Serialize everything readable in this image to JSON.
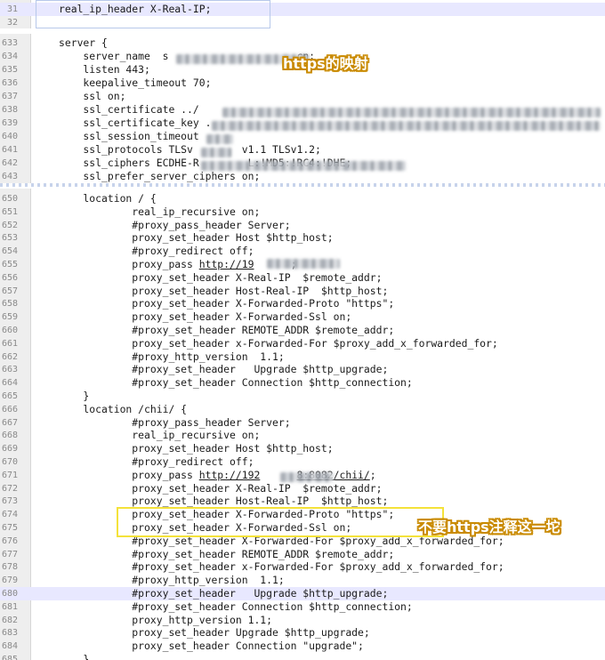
{
  "top_panel": {
    "lines": [
      {
        "num": "31",
        "text": "real_ip_header X-Real-IP;"
      },
      {
        "num": "32",
        "text": ""
      }
    ]
  },
  "main_panel": {
    "lines": [
      {
        "num": "633",
        "text": "server {"
      },
      {
        "num": "634",
        "text": "    server_name  s",
        "text_after": ".cn;"
      },
      {
        "num": "635",
        "text": "    listen 443;"
      },
      {
        "num": "636",
        "text": "    keepalive_timeout 70;"
      },
      {
        "num": "637",
        "text": "    ssl on;"
      },
      {
        "num": "638",
        "text": "    ssl_certificate ../"
      },
      {
        "num": "639",
        "text": "    ssl_certificate_key ."
      },
      {
        "num": "640",
        "text": "    ssl_session_timeout"
      },
      {
        "num": "641",
        "text": "    ssl_protocols TLSv",
        "text_after": "v1.1 TLSv1.2;"
      },
      {
        "num": "642",
        "text": "    ssl_ciphers ECDHE-R",
        "text_after": "L:!MD5:!RC4:!DHE;"
      },
      {
        "num": "643",
        "text": "    ssl_prefer_server_ciphers on;"
      }
    ]
  },
  "bottom_panel": {
    "lines": [
      {
        "num": "650",
        "text": "    location / {"
      },
      {
        "num": "651",
        "text": "            real_ip_recursive on;"
      },
      {
        "num": "652",
        "text": "            #proxy_pass_header Server;"
      },
      {
        "num": "653",
        "text": "            proxy_set_header Host $http_host;"
      },
      {
        "num": "654",
        "text": "            #proxy_redirect off;"
      },
      {
        "num": "655",
        "text": "            proxy_pass ",
        "link": "http://19",
        "text_after": ";"
      },
      {
        "num": "656",
        "text": "            proxy_set_header X-Real-IP  $remote_addr;"
      },
      {
        "num": "657",
        "text": "            proxy_set_header Host-Real-IP  $http_host;"
      },
      {
        "num": "658",
        "text": "            proxy_set_header X-Forwarded-Proto \"https\";"
      },
      {
        "num": "659",
        "text": "            proxy_set_header X-Forwarded-Ssl on;"
      },
      {
        "num": "660",
        "text": "            #proxy_set_header REMOTE_ADDR $remote_addr;"
      },
      {
        "num": "661",
        "text": "            proxy_set_header x-Forwarded-For $proxy_add_x_forwarded_for;"
      },
      {
        "num": "662",
        "text": "            #proxy_http_version  1.1;"
      },
      {
        "num": "663",
        "text": "            #proxy_set_header   Upgrade $http_upgrade;"
      },
      {
        "num": "664",
        "text": "            #proxy_set_header Connection $http_connection;"
      },
      {
        "num": "665",
        "text": "    }"
      },
      {
        "num": "666",
        "text": "    location /chii/ {"
      },
      {
        "num": "667",
        "text": "            #proxy_pass_header Server;"
      },
      {
        "num": "668",
        "text": "            real_ip_recursive on;"
      },
      {
        "num": "669",
        "text": "            proxy_set_header Host $http_host;"
      },
      {
        "num": "670",
        "text": "            #proxy_redirect off;"
      },
      {
        "num": "671",
        "text": "            proxy_pass ",
        "link": "http://192",
        "link_after": "8:8082/chii/",
        "text_after": ";"
      },
      {
        "num": "672",
        "text": "            proxy_set_header X-Real-IP  $remote_addr;"
      },
      {
        "num": "673",
        "text": "            proxy_set_header Host-Real-IP  $http_host;"
      },
      {
        "num": "674",
        "text": "            proxy_set_header X-Forwarded-Proto \"https\";"
      },
      {
        "num": "675",
        "text": "            proxy_set_header X-Forwarded-Ssl on;"
      },
      {
        "num": "676",
        "text": "            #proxy_set_header X-Forwarded-For $proxy_add_x_forwarded_for;"
      },
      {
        "num": "677",
        "text": "            #proxy_set_header REMOTE_ADDR $remote_addr;"
      },
      {
        "num": "678",
        "text": "            #proxy_set_header x-Forwarded-For $proxy_add_x_forwarded_for;"
      },
      {
        "num": "679",
        "text": "            #proxy_http_version  1.1;"
      },
      {
        "num": "680",
        "text": "            #proxy_set_header   Upgrade $http_upgrade;"
      },
      {
        "num": "681",
        "text": "            #proxy_set_header Connection $http_connection;"
      },
      {
        "num": "682",
        "text": "            proxy_http_version 1.1;"
      },
      {
        "num": "683",
        "text": "            proxy_set_header Upgrade $http_upgrade;"
      },
      {
        "num": "684",
        "text": "            proxy_set_header Connection \"upgrade\";"
      },
      {
        "num": "685",
        "text": "    }"
      }
    ]
  },
  "annotations": {
    "https_mapping": "https的映射",
    "no_https_comment": "不要https注释这一坨"
  },
  "colors": {
    "callout_text": "#ffffff",
    "callout_outline": "#c98a00",
    "highlight_box": "#f4e23a",
    "current_line": "#e8e8ff"
  }
}
